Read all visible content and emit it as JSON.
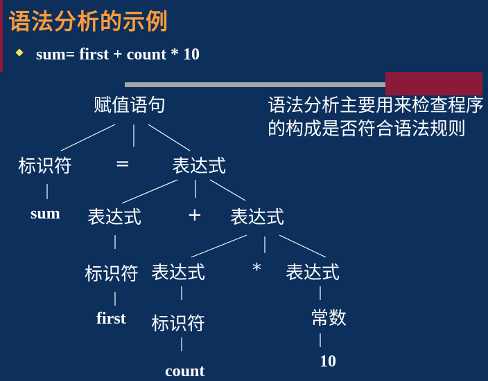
{
  "slide": {
    "title": "语法分析的示例",
    "bullet": "sum= first + count * 10",
    "note": "语法分析主要用来检查程序的构成是否符合语法规则"
  },
  "tree": {
    "root": "赋值语句",
    "id1": "标识符",
    "assign": "=",
    "expr1": "表达式",
    "sum": "sum",
    "expr2": "表达式",
    "plus": "+",
    "expr3": "表达式",
    "id2": "标识符",
    "expr4": "表达式",
    "times": "*",
    "expr5": "表达式",
    "first": "first",
    "id3": "标识符",
    "const": "常数",
    "count": "count",
    "ten": "10"
  },
  "colors": {
    "background": "#0c2f5c",
    "title": "#ff9c3a",
    "accent_maroon": "#8b1a3a",
    "bullet": "#f2e85a",
    "rule": "#a6a6a6"
  }
}
